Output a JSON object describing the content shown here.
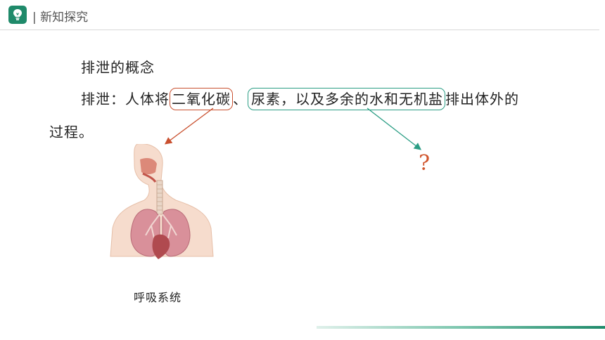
{
  "header": {
    "title": "| 新知探究"
  },
  "content": {
    "subtitle": "排泄的概念",
    "definition": {
      "prefix": "排泄：人体将",
      "term_red": "二氧化碳",
      "separator": "、",
      "term_green": "尿素，以及多余的水和无机盐",
      "suffix": "排出体外的",
      "line2": "过程。"
    },
    "question_mark": "?",
    "figure_caption": "呼吸系统"
  },
  "colors": {
    "brand_green": "#1f8a6a",
    "red_box": "#c9502f",
    "green_box": "#2a9d84",
    "question": "#d0542b"
  },
  "icons": {
    "logo": "lightbulb-icon"
  }
}
